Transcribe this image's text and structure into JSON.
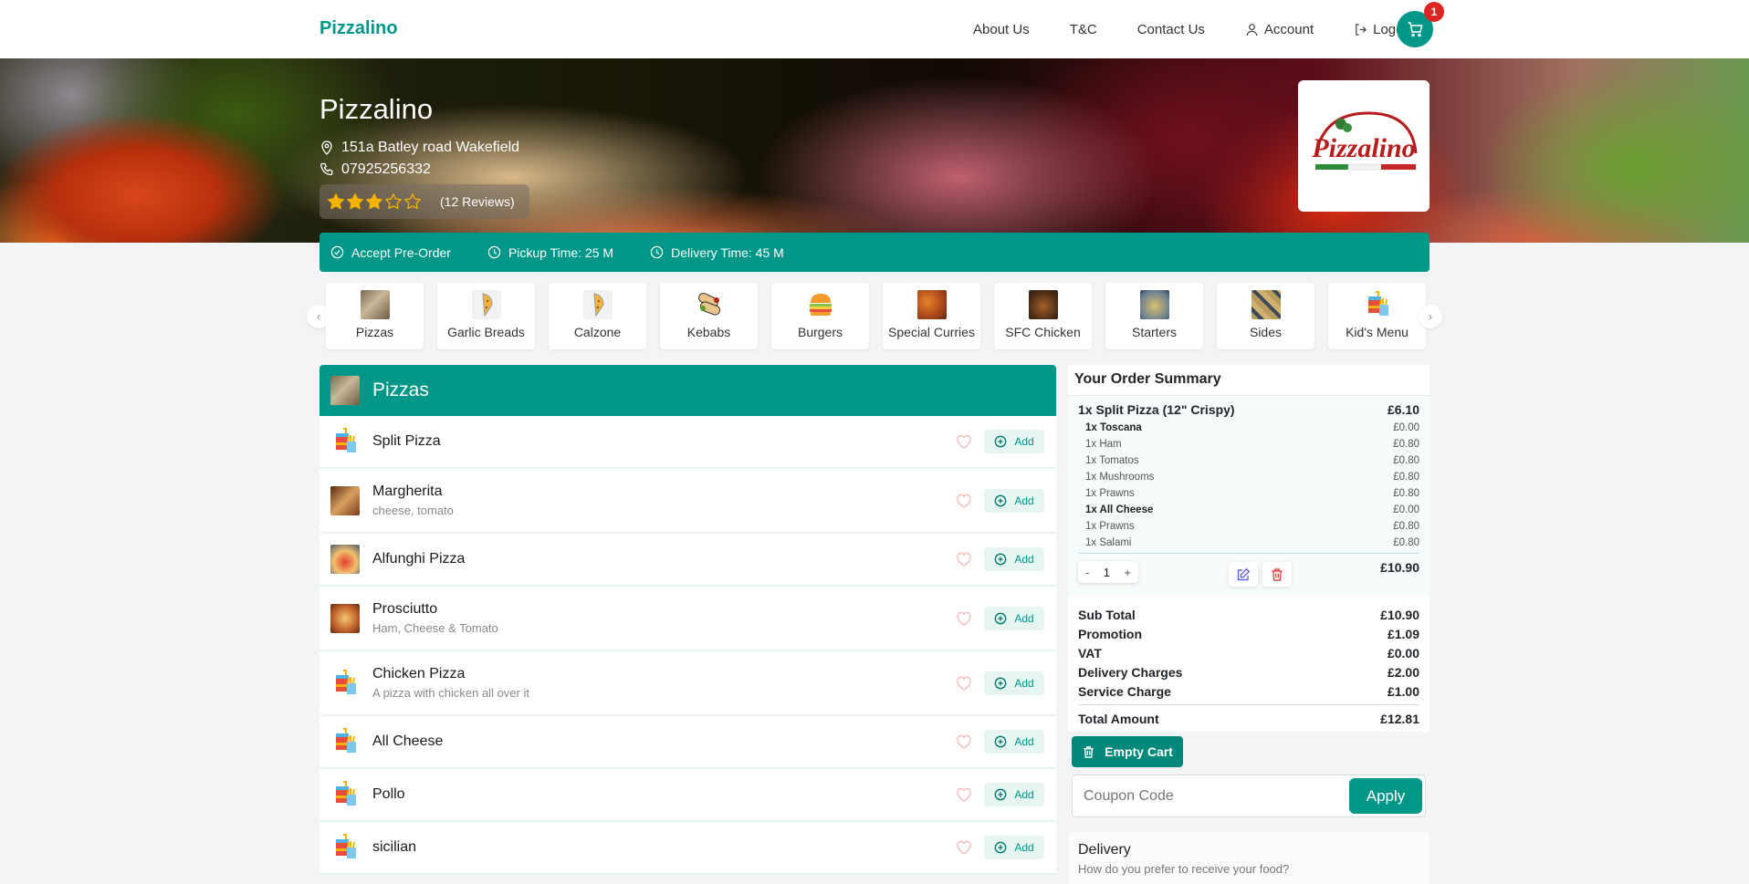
{
  "navbar": {
    "brand": "Pizzalino",
    "links": [
      {
        "label": "About Us",
        "icon": ""
      },
      {
        "label": "T&C",
        "icon": ""
      },
      {
        "label": "Contact Us",
        "icon": ""
      },
      {
        "label": "Account",
        "icon": "user-icon"
      },
      {
        "label": "Logout",
        "icon": "logout-icon"
      }
    ],
    "cart_badge": "1"
  },
  "hero": {
    "title": "Pizzalino",
    "address": "151a Batley road Wakefield",
    "phone": "07925256332",
    "rating": 3,
    "rating_max": 5,
    "reviews": "(12 Reviews)",
    "logo_text": "Pizzalino"
  },
  "info_bar": {
    "items": [
      {
        "label": "Accept Pre-Order",
        "icon": "check-circle-icon"
      },
      {
        "label": "Pickup Time: 25 M",
        "icon": "clock-icon"
      },
      {
        "label": "Delivery Time: 45 M",
        "icon": "clock-icon"
      }
    ]
  },
  "categories": [
    {
      "label": "Pizzas",
      "icon": "pizza-photo"
    },
    {
      "label": "Garlic Breads",
      "icon": "pizza-slice-icon"
    },
    {
      "label": "Calzone",
      "icon": "pizza-slice-icon"
    },
    {
      "label": "Kebabs",
      "icon": "wrap-icon"
    },
    {
      "label": "Burgers",
      "icon": "burger-icon"
    },
    {
      "label": "Special Curries",
      "icon": "curry-photo"
    },
    {
      "label": "SFC Chicken",
      "icon": "chicken-photo"
    },
    {
      "label": "Starters",
      "icon": "starters-photo"
    },
    {
      "label": "Sides",
      "icon": "sides-photo"
    },
    {
      "label": "Kid's Menu",
      "icon": "kids-meal-icon"
    }
  ],
  "menu": {
    "section_title": "Pizzas",
    "add_label": "Add",
    "items": [
      {
        "name": "Split Pizza",
        "desc": "",
        "thumb": "kids-meal"
      },
      {
        "name": "Margherita",
        "desc": "cheese, tomato",
        "thumb": "photo"
      },
      {
        "name": "Alfunghi Pizza",
        "desc": "",
        "thumb": "photo"
      },
      {
        "name": "Prosciutto",
        "desc": "Ham, Cheese & Tomato",
        "thumb": "photo"
      },
      {
        "name": "Chicken Pizza",
        "desc": "A pizza with chicken all over it",
        "thumb": "kids-meal"
      },
      {
        "name": "All Cheese",
        "desc": "",
        "thumb": "kids-meal"
      },
      {
        "name": "Pollo",
        "desc": "",
        "thumb": "kids-meal"
      },
      {
        "name": "sicilian",
        "desc": "",
        "thumb": "kids-meal"
      }
    ]
  },
  "summary": {
    "title": "Your Order Summary",
    "order": {
      "name": "1x Split Pizza (12\" Crispy)",
      "price": "£6.10",
      "options": [
        {
          "label": "1x Toscana",
          "price": "£0.00",
          "bold": true
        },
        {
          "label": "1x Ham",
          "price": "£0.80",
          "bold": false
        },
        {
          "label": "1x Tomatos",
          "price": "£0.80",
          "bold": false
        },
        {
          "label": "1x Mushrooms",
          "price": "£0.80",
          "bold": false
        },
        {
          "label": "1x Prawns",
          "price": "£0.80",
          "bold": false
        },
        {
          "label": "1x All Cheese",
          "price": "£0.00",
          "bold": true
        },
        {
          "label": "1x Prawns",
          "price": "£0.80",
          "bold": false
        },
        {
          "label": "1x Salami",
          "price": "£0.80",
          "bold": false
        }
      ],
      "qty_minus": "-",
      "qty": "1",
      "qty_plus": "+",
      "line_total": "£10.90"
    },
    "totals": [
      {
        "label": "Sub Total",
        "value": "£10.90"
      },
      {
        "label": "Promotion",
        "value": "£1.09"
      },
      {
        "label": "VAT",
        "value": "£0.00"
      },
      {
        "label": "Delivery Charges",
        "value": "£2.00"
      },
      {
        "label": "Service Charge",
        "value": "£1.00"
      }
    ],
    "grand_total": {
      "label": "Total Amount",
      "value": "£12.81"
    },
    "empty_cart": "Empty Cart",
    "coupon_placeholder": "Coupon Code",
    "coupon_value": "",
    "apply": "Apply",
    "delivery_title": "Delivery",
    "delivery_sub": "How do you prefer to receive your food?"
  },
  "colors": {
    "primary": "#009688",
    "badge": "#dc2626",
    "star": "#f5b301",
    "heart": "#f4b8b8",
    "edit": "#6366f1",
    "delete": "#ef4444"
  }
}
